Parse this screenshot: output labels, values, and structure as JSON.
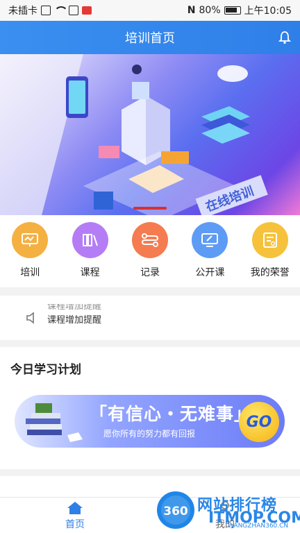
{
  "status": {
    "carrier": "未插卡",
    "battery": "80%",
    "time": "上午10:05"
  },
  "header": {
    "title": "培训首页"
  },
  "banner": {
    "label": "在线培训"
  },
  "menu": [
    {
      "label": "培训",
      "color": "#f5b042"
    },
    {
      "label": "课程",
      "color": "#b57df5"
    },
    {
      "label": "记录",
      "color": "#f57b51"
    },
    {
      "label": "公开课",
      "color": "#5d9bf5"
    },
    {
      "label": "我的荣誉",
      "color": "#f6c23b"
    }
  ],
  "notice": {
    "lines": [
      "课程增加提醒",
      "课程增加提醒"
    ]
  },
  "plan": {
    "title": "今日学习计划",
    "card_main": "「有信心・无难事」",
    "card_sub": "愿你所有的努力都有回报",
    "go": "GO"
  },
  "tabbar": {
    "tabs": [
      {
        "label": "首页",
        "active": true
      },
      {
        "label": "我的",
        "active": false
      }
    ]
  },
  "watermark": {
    "logo": "360",
    "text": "网站排行榜",
    "url": "ITMOP.COM",
    "small": "WANGZHAN360.CN"
  }
}
